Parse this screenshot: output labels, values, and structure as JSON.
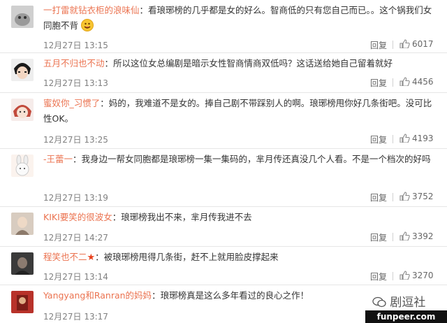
{
  "actions": {
    "reply": "回复"
  },
  "colors": {
    "username": "#eb7350",
    "meta": "#808080",
    "star": "#e8401c"
  },
  "comments": [
    {
      "user": "一打雷就钻衣柜的浪味仙",
      "text": "：看琅琊榜的几乎都是女的好么。智商低的只有您自己而已。。这个锅我们女同胞不背",
      "time": "12月27日 13:15",
      "likes": "6017",
      "emoji": "smile-emoji"
    },
    {
      "user": "五月不归也不动",
      "text": "：所以这位女总编剧是暗示女性智商情商双低吗？这话送给她自己留着就好",
      "time": "12月27日 13:13",
      "likes": "4456"
    },
    {
      "user": "蜜奴你_习惯了",
      "text": "：妈的，我难道不是女的。捧自己剧不带踩别人的啊。琅琊榜甩你好几条街吧。没可比性OK。",
      "time": "12月27日 13:25",
      "likes": "4193"
    },
    {
      "user": "-王蕾一",
      "text": "：我身边一帮女同胞都是琅琊榜一集一集码的，芈月传还真没几个人看。不是一个档次的好吗",
      "time": "12月27日 13:19",
      "likes": "3752"
    },
    {
      "user": "KIKI要笑的很波女",
      "text": "：琅琊榜我出不来，芈月传我进不去",
      "time": "12月27日 14:27",
      "likes": "3392"
    },
    {
      "user": "程笑也不二",
      "text": "：被琅琊榜甩得几条街，赶不上就用脸皮撑起来",
      "time": "12月27日 13:14",
      "likes": "3270",
      "badge": "★"
    },
    {
      "user": "Yangyang和Ranran的妈妈",
      "text": "：琅琊榜真是这么多年看过的良心之作！",
      "time": "12月27日 13:17",
      "likes": ""
    }
  ],
  "watermark": {
    "brand": "剧逗社",
    "url": "funpeer.com"
  }
}
